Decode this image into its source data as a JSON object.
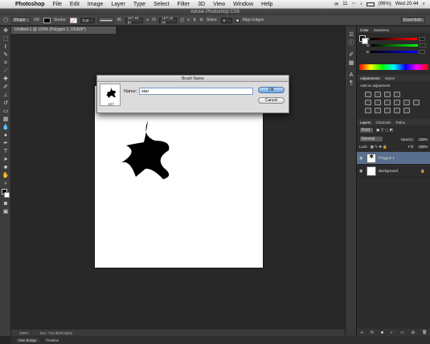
{
  "menubar": {
    "app_name": "Photoshop",
    "items": [
      "File",
      "Edit",
      "Image",
      "Layer",
      "Type",
      "Select",
      "Filter",
      "3D",
      "View",
      "Window",
      "Help"
    ],
    "status": {
      "app_badge": "11",
      "battery": "(96%)",
      "clock": "Wed 20:44"
    }
  },
  "window_title": "Adobe Photoshop CS6",
  "options_bar": {
    "mode": "Shape",
    "fill_label": "Fill:",
    "stroke_label": "Stroke:",
    "stroke_width": "3 pt",
    "w_label": "W:",
    "w_value": "157.93 px",
    "h_label": "H:",
    "h_value": "167.15 px",
    "sides_label": "Sides:",
    "sides_value": "6",
    "align_edges": "Align Edges",
    "workspace": "Essentials"
  },
  "document": {
    "tab_title": "Untitled-1 @ 100% (Polygon 1, RGB/8*)",
    "zoom": "100%",
    "doc_size": "Doc: 712.9K/0 bytes"
  },
  "bottom_tabs": [
    "Mini Bridge",
    "Timeline"
  ],
  "color_panel": {
    "tabs": [
      "Color",
      "Swatches"
    ],
    "channels": [
      {
        "label": "R",
        "value": ""
      },
      {
        "label": "G",
        "value": ""
      },
      {
        "label": "B",
        "value": ""
      }
    ]
  },
  "adjustments_panel": {
    "tabs": [
      "Adjustments",
      "Styles"
    ],
    "heading": "Add an adjustment"
  },
  "layers_panel": {
    "tabs": [
      "Layers",
      "Channels",
      "Paths"
    ],
    "kind": "Kind",
    "blend_mode": "Normal",
    "opacity_label": "Opacity:",
    "opacity_value": "100%",
    "lock_label": "Lock:",
    "fill_label": "Fill:",
    "fill_value": "100%",
    "layers": [
      {
        "name": "Polygon 1",
        "selected": true
      },
      {
        "name": "Background",
        "selected": false
      }
    ]
  },
  "dialog": {
    "title": "Brush Name",
    "brush_size": "167",
    "name_label": "Name:",
    "name_value": "star",
    "ok_label": "OK",
    "cancel_label": "Cancel"
  },
  "colors": {
    "selected_layer": "#5a6f8f",
    "ok_button": "#6aa6e0"
  }
}
